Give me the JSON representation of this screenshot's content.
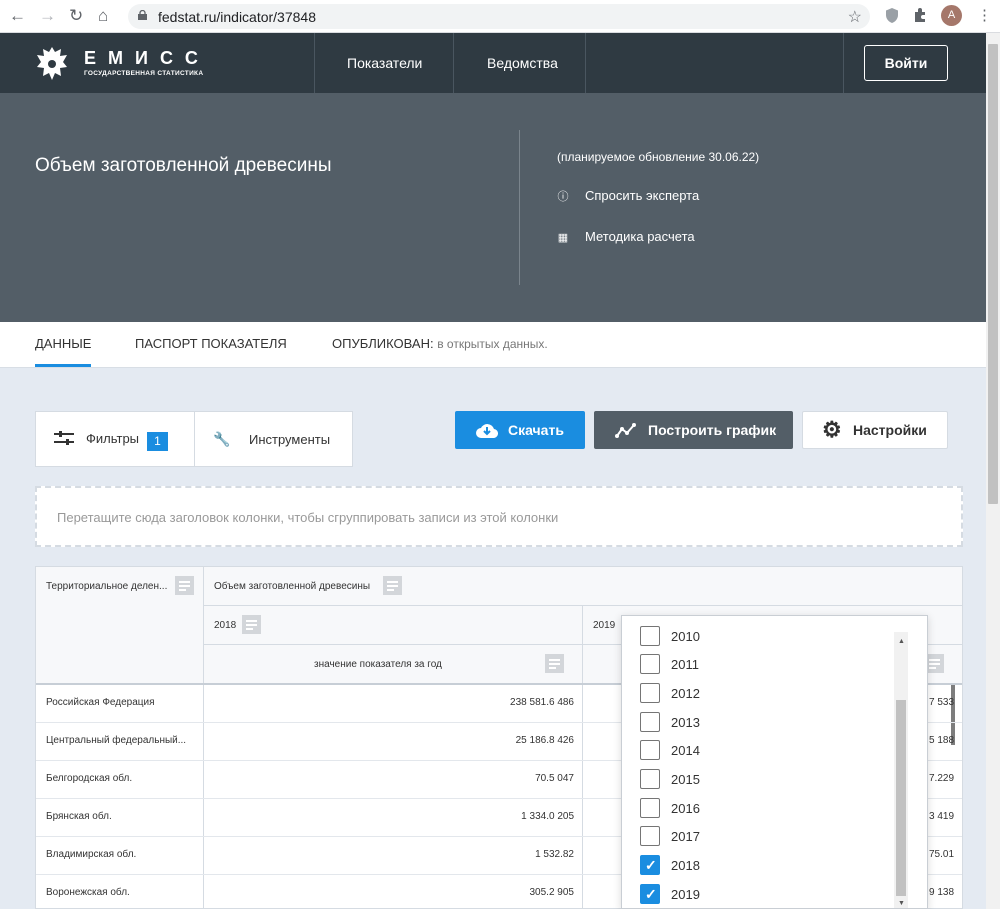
{
  "browser": {
    "url": "fedstat.ru/indicator/37848",
    "avatar_letter": "A"
  },
  "site": {
    "logo_title": "ЕМИСС",
    "logo_subtitle": "ГОСУДАРСТВЕННАЯ СТАТИСТИКА",
    "nav": [
      "Показатели",
      "Ведомства"
    ],
    "login_label": "Войти"
  },
  "hero": {
    "title": "Объем заготовленной древесины",
    "update_note": "(планируемое обновление 30.06.22)",
    "ask_expert": "Спросить эксперта",
    "methodology": "Методика расчета"
  },
  "tabs": {
    "data": "ДАННЫЕ",
    "passport": "ПАСПОРТ ПОКАЗАТЕЛЯ",
    "published_label": "ОПУБЛИКОВАН:",
    "published_value": "в открытых данных."
  },
  "toolbar": {
    "filters_label": "Фильтры",
    "filters_count": "1",
    "tools_label": "Инструменты",
    "download_label": "Скачать",
    "chart_label": "Построить график",
    "settings_label": "Настройки"
  },
  "group_zone": {
    "hint": "Перетащите сюда заголовок колонки, чтобы сгруппировать записи из этой колонки"
  },
  "table": {
    "col_territory": "Территориальное делен...",
    "col_measure": "Объем заготовленной древесины",
    "year_2018": "2018",
    "year_2019": "2019",
    "sub_header": "значение показателя за год",
    "rows": [
      {
        "name": "Российская Федерация",
        "v2018": "238 581.6 486",
        "v2019": "7 533"
      },
      {
        "name": "Центральный федеральный...",
        "v2018": "25 186.8 426",
        "v2019": "5 188"
      },
      {
        "name": "Белгородская обл.",
        "v2018": "70.5 047",
        "v2019": "7.229"
      },
      {
        "name": "Брянская обл.",
        "v2018": "1 334.0 205",
        "v2019": "3 419"
      },
      {
        "name": "Владимирская обл.",
        "v2018": "1 532.82",
        "v2019": "75.01"
      },
      {
        "name": "Воронежская обл.",
        "v2018": "305.2 905",
        "v2019": "9 138"
      }
    ]
  },
  "year_filter": {
    "options": [
      {
        "label": "2010",
        "checked": false
      },
      {
        "label": "2011",
        "checked": false
      },
      {
        "label": "2012",
        "checked": false
      },
      {
        "label": "2013",
        "checked": false
      },
      {
        "label": "2014",
        "checked": false
      },
      {
        "label": "2015",
        "checked": false
      },
      {
        "label": "2016",
        "checked": false
      },
      {
        "label": "2017",
        "checked": false
      },
      {
        "label": "2018",
        "checked": true
      },
      {
        "label": "2019",
        "checked": true
      }
    ]
  },
  "colors": {
    "accent": "#1a8de0",
    "header_dark": "#2f3a42",
    "hero_bg": "#535e67"
  }
}
